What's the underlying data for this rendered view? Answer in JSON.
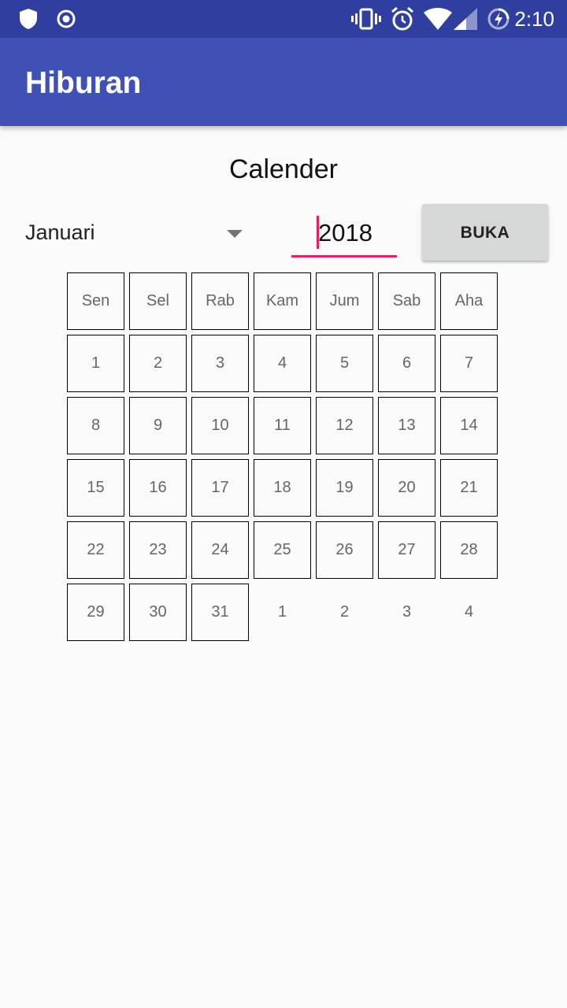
{
  "status_bar": {
    "time": "2:10",
    "icons": [
      "shield-icon",
      "record-icon",
      "vibrate-icon",
      "alarm-icon",
      "wifi-icon",
      "signal-icon",
      "battery-charging-icon"
    ]
  },
  "app_bar": {
    "title": "Hiburan"
  },
  "main": {
    "heading": "Calender",
    "month_selected": "Januari",
    "year_value": "2018",
    "open_button_label": "BUKA"
  },
  "calendar": {
    "weekdays": [
      "Sen",
      "Sel",
      "Rab",
      "Kam",
      "Jum",
      "Sab",
      "Aha"
    ],
    "weeks": [
      [
        {
          "d": "1",
          "box": true
        },
        {
          "d": "2",
          "box": true
        },
        {
          "d": "3",
          "box": true
        },
        {
          "d": "4",
          "box": true
        },
        {
          "d": "5",
          "box": true
        },
        {
          "d": "6",
          "box": true
        },
        {
          "d": "7",
          "box": true
        }
      ],
      [
        {
          "d": "8",
          "box": true
        },
        {
          "d": "9",
          "box": true
        },
        {
          "d": "10",
          "box": true
        },
        {
          "d": "11",
          "box": true
        },
        {
          "d": "12",
          "box": true
        },
        {
          "d": "13",
          "box": true
        },
        {
          "d": "14",
          "box": true
        }
      ],
      [
        {
          "d": "15",
          "box": true
        },
        {
          "d": "16",
          "box": true
        },
        {
          "d": "17",
          "box": true
        },
        {
          "d": "18",
          "box": true
        },
        {
          "d": "19",
          "box": true
        },
        {
          "d": "20",
          "box": true
        },
        {
          "d": "21",
          "box": true
        }
      ],
      [
        {
          "d": "22",
          "box": true
        },
        {
          "d": "23",
          "box": true
        },
        {
          "d": "24",
          "box": true
        },
        {
          "d": "25",
          "box": true
        },
        {
          "d": "26",
          "box": true
        },
        {
          "d": "27",
          "box": true
        },
        {
          "d": "28",
          "box": true
        }
      ],
      [
        {
          "d": "29",
          "box": true
        },
        {
          "d": "30",
          "box": true
        },
        {
          "d": "31",
          "box": true
        },
        {
          "d": "1",
          "box": false
        },
        {
          "d": "2",
          "box": false
        },
        {
          "d": "3",
          "box": false
        },
        {
          "d": "4",
          "box": false
        }
      ]
    ]
  },
  "colors": {
    "status_bar": "#303f9f",
    "app_bar": "#3f51b5",
    "accent": "#e91e63",
    "button": "#d6d7d7",
    "background": "#fafafa"
  }
}
